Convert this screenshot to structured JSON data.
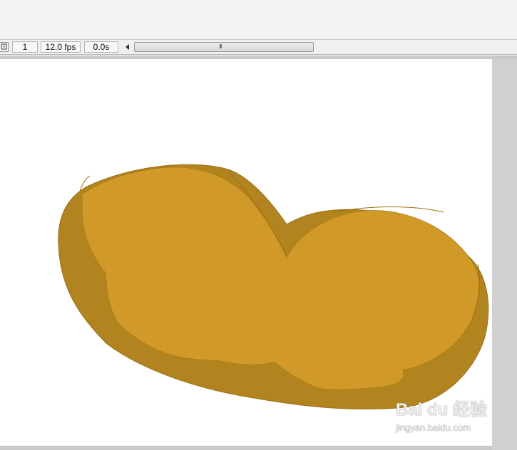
{
  "timeline": {
    "frame": "1",
    "fps": "12.0 fps",
    "elapsed": "0.0s",
    "scroll_grip": "III"
  },
  "icons": {
    "center_frame": "center-frame-icon",
    "scroll_left": "scroll-left-arrow-icon"
  },
  "colors": {
    "shape_light": "#d19a28",
    "shape_dark": "#b2841f",
    "stroke": "#9a6f12"
  },
  "watermark": {
    "brand": "Bai du 经验",
    "url": "jingyan.baidu.com"
  }
}
